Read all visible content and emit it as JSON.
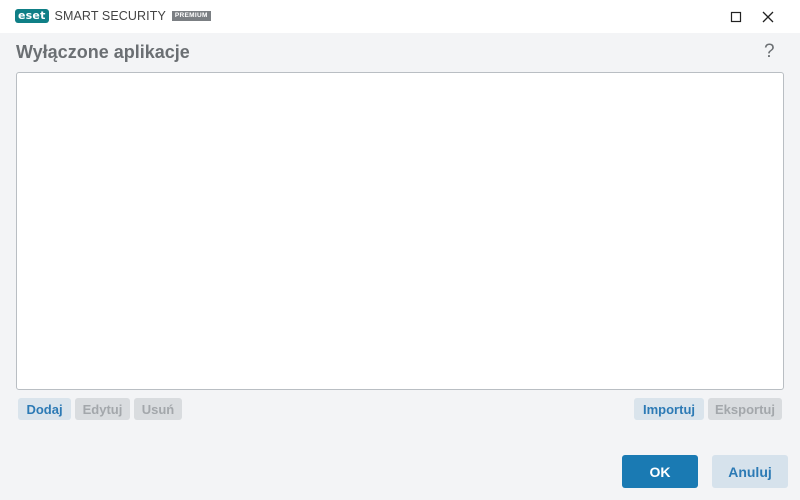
{
  "titlebar": {
    "logo_text": "eset",
    "product_name": "SMART SECURITY",
    "edition": "PREMIUM",
    "maximize_icon": "square-outline-icon",
    "close_icon": "x-icon"
  },
  "dialog": {
    "title": "Wyłączone aplikacje",
    "help_label": "?",
    "list_items": []
  },
  "toolbar": {
    "add_label": "Dodaj",
    "edit_label": "Edytuj",
    "delete_label": "Usuń",
    "import_label": "Importuj",
    "export_label": "Eksportuj"
  },
  "footer": {
    "ok_label": "OK",
    "cancel_label": "Anuluj"
  },
  "colors": {
    "brand_teal": "#0f7f86",
    "primary_button": "#1a7ab3",
    "secondary_button": "#d6e2ec"
  }
}
